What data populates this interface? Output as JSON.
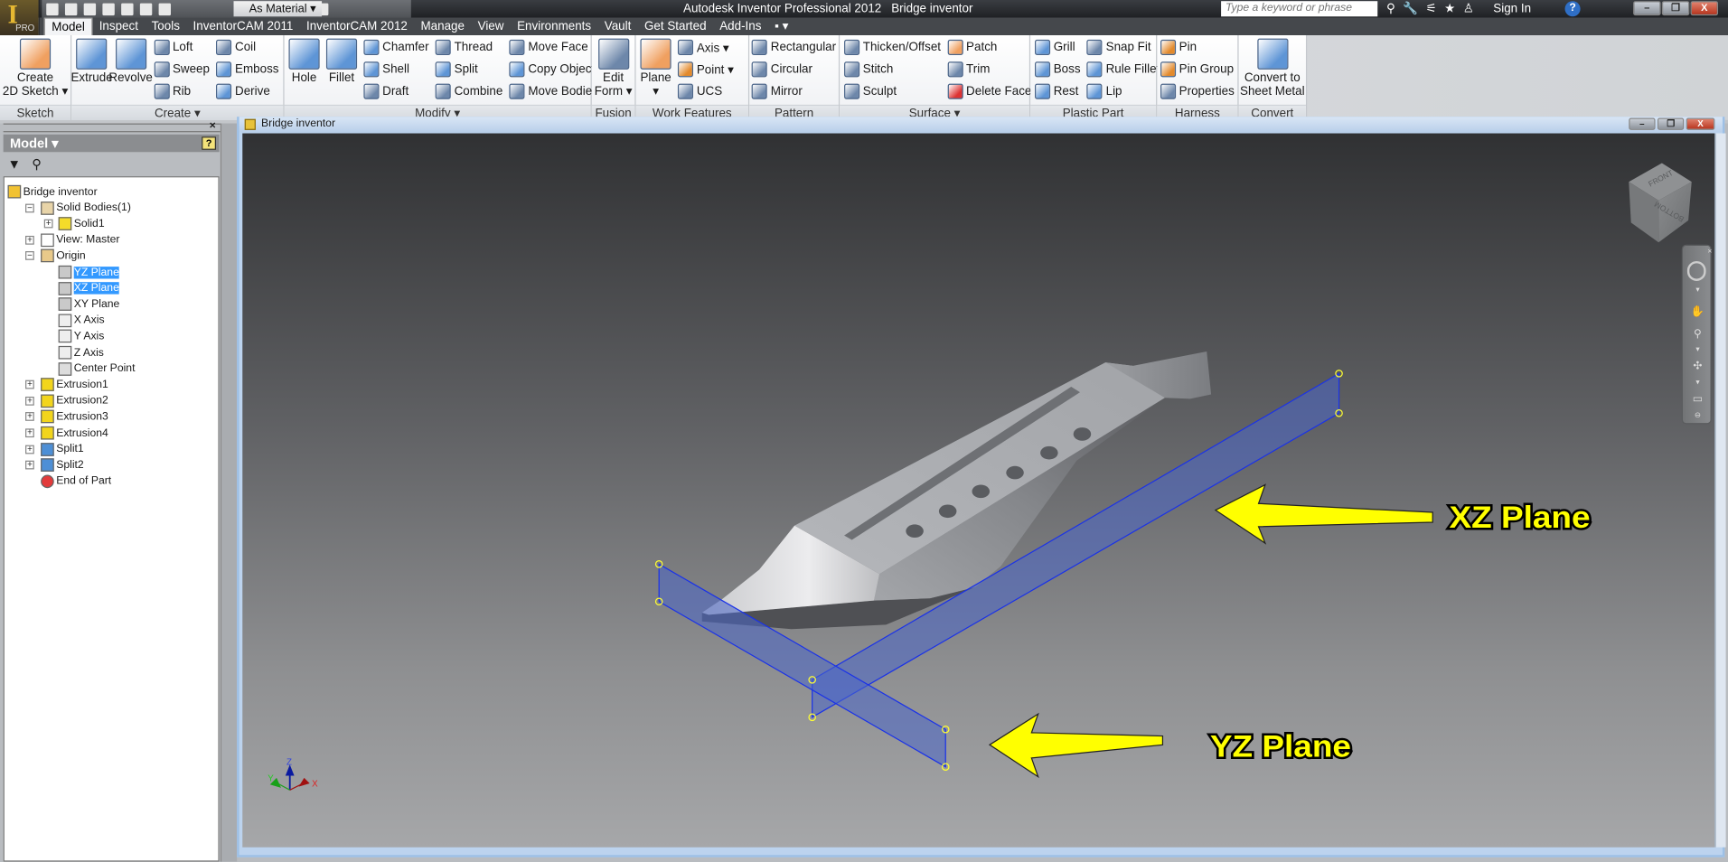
{
  "app": {
    "title": "Autodesk Inventor Professional 2012",
    "document": "Bridge inventor",
    "badge": "PRO"
  },
  "quick_access": {
    "material": "As Material",
    "icons": [
      "new-icon",
      "open-icon",
      "save-icon",
      "undo-icon",
      "redo-icon",
      "return-icon",
      "select-icon",
      "fx-icon",
      "color-icon",
      "plus-icon"
    ]
  },
  "search": {
    "placeholder": "Type a keyword or phrase"
  },
  "account": {
    "sign_in": "Sign In",
    "help": "?"
  },
  "window_controls": {
    "minimize": "–",
    "restore": "❐",
    "close": "X"
  },
  "tabs": [
    {
      "label": "Model",
      "active": true
    },
    {
      "label": "Inspect"
    },
    {
      "label": "Tools"
    },
    {
      "label": "InventorCAM 2011"
    },
    {
      "label": "InventorCAM 2012"
    },
    {
      "label": "Manage"
    },
    {
      "label": "View"
    },
    {
      "label": "Environments"
    },
    {
      "label": "Vault"
    },
    {
      "label": "Get Started"
    },
    {
      "label": "Add-Ins"
    },
    {
      "label": "▪ ▾"
    }
  ],
  "ribbon": {
    "groups": [
      {
        "label": "Sketch",
        "columns": [
          {
            "type": "big",
            "items": [
              {
                "label": "Create\n2D Sketch ▾",
                "icon": "sketch-icon"
              }
            ]
          }
        ]
      },
      {
        "label": "Create ▾",
        "columns": [
          {
            "type": "big",
            "items": [
              {
                "label": "Extrude",
                "icon": "extrude-icon"
              }
            ]
          },
          {
            "type": "big",
            "items": [
              {
                "label": "Revolve",
                "icon": "revolve-icon"
              }
            ]
          },
          {
            "type": "small",
            "items": [
              {
                "label": "Loft",
                "icon": "loft-icon"
              },
              {
                "label": "Sweep",
                "icon": "sweep-icon"
              },
              {
                "label": "Rib",
                "icon": "rib-icon"
              }
            ]
          },
          {
            "type": "small",
            "items": [
              {
                "label": "Coil",
                "icon": "coil-icon"
              },
              {
                "label": "Emboss",
                "icon": "emboss-icon"
              },
              {
                "label": "Derive",
                "icon": "derive-icon"
              }
            ]
          }
        ]
      },
      {
        "label": "Modify ▾",
        "columns": [
          {
            "type": "big",
            "items": [
              {
                "label": "Hole",
                "icon": "hole-icon"
              }
            ]
          },
          {
            "type": "big",
            "items": [
              {
                "label": "Fillet",
                "icon": "fillet-icon"
              }
            ]
          },
          {
            "type": "small",
            "items": [
              {
                "label": "Chamfer",
                "icon": "chamfer-icon"
              },
              {
                "label": "Shell",
                "icon": "shell-icon"
              },
              {
                "label": "Draft",
                "icon": "draft-icon"
              }
            ]
          },
          {
            "type": "small",
            "items": [
              {
                "label": "Thread",
                "icon": "thread-icon"
              },
              {
                "label": "Split",
                "icon": "split-icon"
              },
              {
                "label": "Combine",
                "icon": "combine-icon"
              }
            ]
          },
          {
            "type": "small",
            "items": [
              {
                "label": "Move Face",
                "icon": "move-face-icon"
              },
              {
                "label": "Copy Object",
                "icon": "copy-object-icon"
              },
              {
                "label": "Move Bodies",
                "icon": "move-bodies-icon"
              }
            ]
          }
        ]
      },
      {
        "label": "Fusion",
        "columns": [
          {
            "type": "big",
            "items": [
              {
                "label": "Edit\nForm ▾",
                "icon": "edit-form-icon"
              }
            ]
          }
        ]
      },
      {
        "label": "Work Features",
        "columns": [
          {
            "type": "big",
            "items": [
              {
                "label": "Plane\n▾",
                "icon": "plane-icon"
              }
            ]
          },
          {
            "type": "small",
            "items": [
              {
                "label": "Axis ▾",
                "icon": "axis-icon"
              },
              {
                "label": "Point ▾",
                "icon": "point-icon"
              },
              {
                "label": "UCS",
                "icon": "ucs-icon"
              }
            ]
          }
        ]
      },
      {
        "label": "Pattern",
        "columns": [
          {
            "type": "small",
            "items": [
              {
                "label": "Rectangular",
                "icon": "rectangular-pattern-icon"
              },
              {
                "label": "Circular",
                "icon": "circular-pattern-icon"
              },
              {
                "label": "Mirror",
                "icon": "mirror-icon"
              }
            ]
          }
        ]
      },
      {
        "label": "Surface ▾",
        "columns": [
          {
            "type": "small",
            "items": [
              {
                "label": "Thicken/Offset",
                "icon": "thicken-icon"
              },
              {
                "label": "Stitch",
                "icon": "stitch-icon"
              },
              {
                "label": "Sculpt",
                "icon": "sculpt-icon"
              }
            ]
          },
          {
            "type": "small",
            "items": [
              {
                "label": "Patch",
                "icon": "patch-icon"
              },
              {
                "label": "Trim",
                "icon": "trim-icon"
              },
              {
                "label": "Delete Face",
                "icon": "delete-face-icon"
              }
            ]
          }
        ]
      },
      {
        "label": "Plastic Part",
        "columns": [
          {
            "type": "small",
            "items": [
              {
                "label": "Grill",
                "icon": "grill-icon"
              },
              {
                "label": "Boss",
                "icon": "boss-icon"
              },
              {
                "label": "Rest",
                "icon": "rest-icon"
              }
            ]
          },
          {
            "type": "small",
            "items": [
              {
                "label": "Snap Fit",
                "icon": "snap-fit-icon"
              },
              {
                "label": "Rule Fillet",
                "icon": "rule-fillet-icon"
              },
              {
                "label": "Lip",
                "icon": "lip-icon"
              }
            ]
          }
        ]
      },
      {
        "label": "Harness",
        "columns": [
          {
            "type": "small",
            "items": [
              {
                "label": "Pin",
                "icon": "pin-icon"
              },
              {
                "label": "Pin Group",
                "icon": "pin-group-icon"
              },
              {
                "label": "Properties",
                "icon": "properties-icon"
              }
            ]
          }
        ]
      },
      {
        "label": "Convert",
        "columns": [
          {
            "type": "big",
            "items": [
              {
                "label": "Convert to\nSheet Metal",
                "icon": "sheet-metal-icon"
              }
            ]
          }
        ]
      }
    ]
  },
  "browser": {
    "title": "Model ▾",
    "help": "?",
    "tree": [
      {
        "label": "Bridge inventor",
        "level": 0,
        "expander": "",
        "icon": "part-icon"
      },
      {
        "label": "Solid Bodies(1)",
        "level": 1,
        "expander": "-",
        "icon": "solid-bodies-icon"
      },
      {
        "label": "Solid1",
        "level": 2,
        "expander": "+",
        "icon": "solid-icon"
      },
      {
        "label": "View: Master",
        "level": 1,
        "expander": "+",
        "icon": "view-icon"
      },
      {
        "label": "Origin",
        "level": 1,
        "expander": "-",
        "icon": "folder-icon"
      },
      {
        "label": "YZ Plane",
        "level": 2,
        "expander": "",
        "icon": "work-plane-icon",
        "selected": true
      },
      {
        "label": "XZ Plane",
        "level": 2,
        "expander": "",
        "icon": "work-plane-icon",
        "selected": true
      },
      {
        "label": "XY Plane",
        "level": 2,
        "expander": "",
        "icon": "work-plane-icon"
      },
      {
        "label": "X Axis",
        "level": 2,
        "expander": "",
        "icon": "work-axis-icon"
      },
      {
        "label": "Y Axis",
        "level": 2,
        "expander": "",
        "icon": "work-axis-icon"
      },
      {
        "label": "Z Axis",
        "level": 2,
        "expander": "",
        "icon": "work-axis-icon"
      },
      {
        "label": "Center Point",
        "level": 2,
        "expander": "",
        "icon": "work-point-icon"
      },
      {
        "label": "Extrusion1",
        "level": 1,
        "expander": "+",
        "icon": "extrusion-icon"
      },
      {
        "label": "Extrusion2",
        "level": 1,
        "expander": "+",
        "icon": "extrusion-icon"
      },
      {
        "label": "Extrusion3",
        "level": 1,
        "expander": "+",
        "icon": "extrusion-icon"
      },
      {
        "label": "Extrusion4",
        "level": 1,
        "expander": "+",
        "icon": "extrusion-icon"
      },
      {
        "label": "Split1",
        "level": 1,
        "expander": "+",
        "icon": "split-feature-icon"
      },
      {
        "label": "Split2",
        "level": 1,
        "expander": "+",
        "icon": "split-feature-icon"
      },
      {
        "label": "End of Part",
        "level": 1,
        "expander": "",
        "icon": "end-of-part-icon"
      }
    ]
  },
  "viewport": {
    "annotations": {
      "xz": "XZ Plane",
      "yz": "YZ Plane"
    },
    "viewcube": {
      "front": "FRONT",
      "bottom": "BOTTOM"
    },
    "triad": {
      "x": "X",
      "y": "Y",
      "z": "Z"
    },
    "colors": {
      "plane_fill": "#4a66c8",
      "plane_edge": "#1a32e8",
      "annotation": "#ffff00",
      "handle": "#ffff33"
    }
  }
}
